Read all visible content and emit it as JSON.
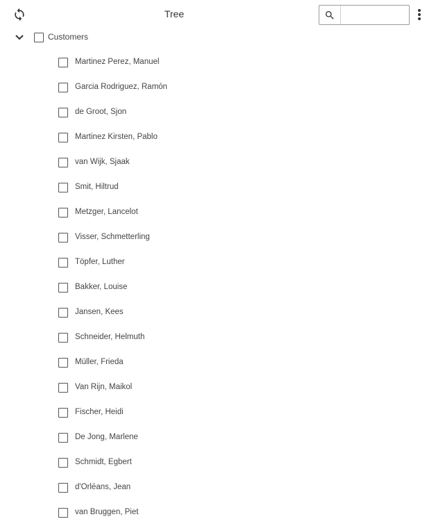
{
  "toolbar": {
    "title": "Tree",
    "refresh_icon": "refresh-icon",
    "search_icon": "search-icon",
    "search_value": "",
    "search_placeholder": "",
    "more_icon": "more-vert-icon"
  },
  "tree": {
    "root": {
      "label": "Customers",
      "expanded": true,
      "checked": false
    },
    "items": [
      {
        "label": "Martinez Perez, Manuel"
      },
      {
        "label": "Garcia Rodriguez, Ramón"
      },
      {
        "label": "de Groot, Sjon"
      },
      {
        "label": "Martinez Kirsten, Pablo"
      },
      {
        "label": "van Wijk, Sjaak"
      },
      {
        "label": "Smit, Hiltrud"
      },
      {
        "label": "Metzger, Lancelot"
      },
      {
        "label": "Visser, Schmetterling"
      },
      {
        "label": "Töpfer, Luther"
      },
      {
        "label": "Bakker, Louise"
      },
      {
        "label": "Jansen, Kees"
      },
      {
        "label": "Schneider, Helmuth"
      },
      {
        "label": "Müller, Frieda"
      },
      {
        "label": "Van Rijn, Maikol"
      },
      {
        "label": "Fischer, Heidi"
      },
      {
        "label": "De Jong, Marlene"
      },
      {
        "label": "Schmidt, Egbert"
      },
      {
        "label": "d'Orléans, Jean"
      },
      {
        "label": "van Bruggen, Piet"
      }
    ]
  },
  "colors": {
    "text": "#444444",
    "border": "#9a9a9a",
    "icon": "#333333"
  }
}
